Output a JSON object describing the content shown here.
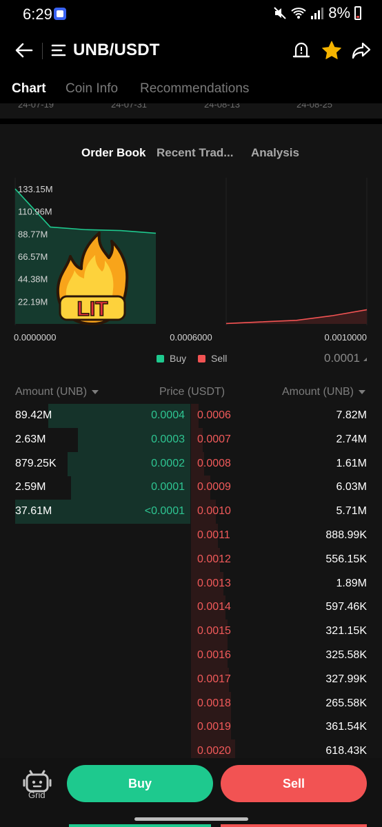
{
  "status_bar": {
    "time": "6:29",
    "battery": "8%"
  },
  "header": {
    "pair": "UNB/USDT"
  },
  "tabs": [
    {
      "label": "Chart"
    },
    {
      "label": "Coin Info"
    },
    {
      "label": "Recommendations"
    }
  ],
  "chart_strip": {
    "dates": [
      "24-07-19",
      "24-07-31",
      "24-08-13",
      "24-08-25"
    ]
  },
  "sub_tabs": [
    {
      "label": "Order Book"
    },
    {
      "label": "Recent Trad..."
    },
    {
      "label": "Analysis"
    }
  ],
  "sticker": {
    "text": "LIT"
  },
  "legend": {
    "buy": "Buy",
    "sell": "Sell"
  },
  "precision": "0.0001",
  "order_book": {
    "headers": {
      "left": "Amount (UNB)",
      "center": "Price (USDT)",
      "right": "Amount (UNB)"
    },
    "bids": [
      {
        "amount": "89.42M",
        "price": "0.0004",
        "depth": 0.81
      },
      {
        "amount": "2.63M",
        "price": "0.0003",
        "depth": 0.64
      },
      {
        "amount": "879.25K",
        "price": "0.0002",
        "depth": 0.7
      },
      {
        "amount": "2.59M",
        "price": "0.0001",
        "depth": 0.68
      },
      {
        "amount": "37.61M",
        "price": "<0.0001",
        "depth": 1.0
      }
    ],
    "asks": [
      {
        "price": "0.0006",
        "amount": "7.82M",
        "depth": 0.04
      },
      {
        "price": "0.0007",
        "amount": "2.74M",
        "depth": 0.06
      },
      {
        "price": "0.0008",
        "amount": "1.61M",
        "depth": 0.07
      },
      {
        "price": "0.0009",
        "amount": "6.03M",
        "depth": 0.1
      },
      {
        "price": "0.0010",
        "amount": "5.71M",
        "depth": 0.13
      },
      {
        "price": "0.0011",
        "amount": "888.99K",
        "depth": 0.14
      },
      {
        "price": "0.0012",
        "amount": "556.15K",
        "depth": 0.15
      },
      {
        "price": "0.0013",
        "amount": "1.89M",
        "depth": 0.17
      },
      {
        "price": "0.0014",
        "amount": "597.46K",
        "depth": 0.18
      },
      {
        "price": "0.0015",
        "amount": "321.15K",
        "depth": 0.19
      },
      {
        "price": "0.0016",
        "amount": "325.58K",
        "depth": 0.19
      },
      {
        "price": "0.0017",
        "amount": "327.99K",
        "depth": 0.2
      },
      {
        "price": "0.0018",
        "amount": "265.58K",
        "depth": 0.21
      },
      {
        "price": "0.0019",
        "amount": "361.54K",
        "depth": 0.21
      },
      {
        "price": "0.0020",
        "amount": "618.43K",
        "depth": 0.23
      }
    ]
  },
  "bottom_bar": {
    "grid_label": "Grid",
    "buy_label": "Buy",
    "sell_label": "Sell"
  },
  "colors": {
    "buy": "#1ec98e",
    "sell": "#f25353",
    "buy_fill": "#15332a",
    "sell_fill": "#2c1818",
    "star": "#f5b400"
  },
  "chart_data": {
    "type": "area",
    "title": "",
    "xlabel": "",
    "ylabel": "",
    "x_ticks": [
      "0.0000000",
      "0.0006000",
      "0.0010000"
    ],
    "y_ticks": [
      "133.15M",
      "110.96M",
      "88.77M",
      "66.57M",
      "44.38M",
      "22.19M"
    ],
    "xlim": [
      0,
      0.001
    ],
    "ylim": [
      0,
      140000000
    ],
    "legend": "bottom-center",
    "series": [
      {
        "name": "Buy",
        "color": "#1ec98e",
        "x": [
          0.0,
          0.0001,
          0.0002,
          0.0003,
          0.0004
        ],
        "y": [
          133150000,
          95530000,
          92940000,
          92060000,
          89420000
        ]
      },
      {
        "name": "Sell",
        "color": "#f25353",
        "x": [
          0.0006,
          0.0007,
          0.0008,
          0.0009,
          0.001
        ],
        "y": [
          400000,
          2000000,
          3500000,
          8000000,
          14000000
        ]
      }
    ]
  }
}
